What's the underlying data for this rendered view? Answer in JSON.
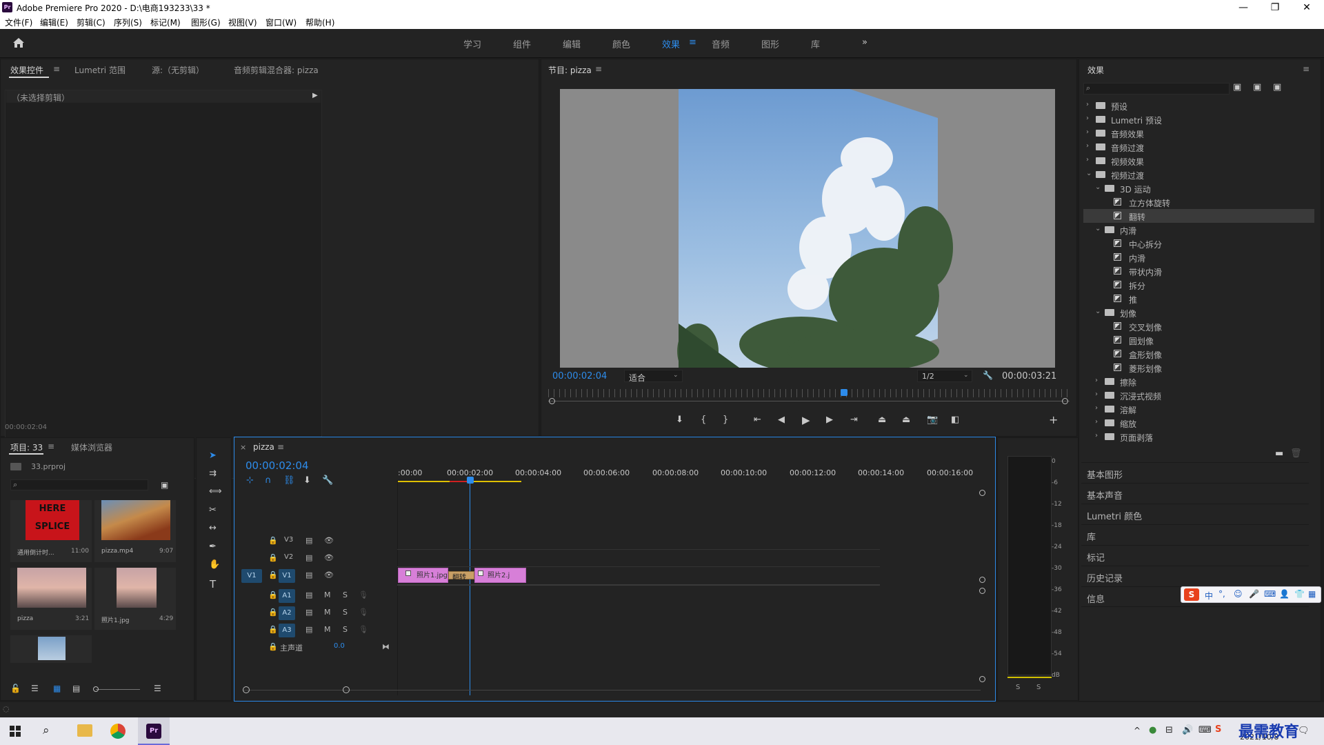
{
  "window": {
    "title": "Adobe Premiere Pro 2020 - D:\\电商193233\\33 *",
    "logo": "Pr",
    "controls": [
      "—",
      "❐",
      "✕"
    ]
  },
  "menu": [
    "文件(F)",
    "编辑(E)",
    "剪辑(C)",
    "序列(S)",
    "标记(M)",
    "图形(G)",
    "视图(V)",
    "窗口(W)",
    "帮助(H)"
  ],
  "workspaces": {
    "items": [
      "学习",
      "组件",
      "编辑",
      "颜色",
      "效果",
      "音频",
      "图形",
      "库"
    ],
    "active": "效果",
    "more": "»",
    "menu_icon": "≡"
  },
  "source_panel": {
    "tabs": [
      "效果控件",
      "Lumetri 范围",
      "源:（无剪辑）",
      "音频剪辑混合器: pizza"
    ],
    "no_clip": "（未选择剪辑）",
    "timecode": "00:00:02:04"
  },
  "program": {
    "title": "节目: pizza",
    "timecode": "00:00:02:04",
    "fit": "适合",
    "quality": "1/2",
    "duration": "00:00:03:21"
  },
  "project": {
    "tabs": [
      "项目: 33",
      "媒体浏览器"
    ],
    "file": "33.prproj",
    "items": [
      {
        "name": "通用倒计时...",
        "duration": "11:00",
        "thumb_text": "HERE SPLICE"
      },
      {
        "name": "pizza.mp4",
        "duration": "9:07"
      },
      {
        "name": "pizza",
        "duration": "3:21"
      },
      {
        "name": "照片1.jpg",
        "duration": "4:29"
      }
    ]
  },
  "timeline": {
    "tab": "pizza",
    "timecode": "00:00:02:04",
    "ruler": [
      ":00:00",
      "00:00:02:00",
      "00:00:04:00",
      "00:00:06:00",
      "00:00:08:00",
      "00:00:10:00",
      "00:00:12:00",
      "00:00:14:00",
      "00:00:16:00"
    ],
    "video_tracks": [
      "V3",
      "V2",
      "V1"
    ],
    "audio_tracks": [
      "A1",
      "A2",
      "A3"
    ],
    "source_patch": "V1",
    "master_label": "主声道",
    "master_value": "0.0",
    "clips": [
      {
        "name": "照片1.jpg"
      },
      {
        "name": "翻转"
      },
      {
        "name": "照片2.j"
      }
    ],
    "track_buttons": {
      "mute": "M",
      "solo": "S"
    }
  },
  "meter": {
    "ticks": [
      "0",
      "-6",
      "-12",
      "-18",
      "-24",
      "-30",
      "-36",
      "-42",
      "-48",
      "-54",
      "dB"
    ],
    "solo": [
      "S",
      "S"
    ]
  },
  "effects": {
    "title": "效果",
    "tree": [
      {
        "label": "预设",
        "level": 0,
        "kind": "folder-special",
        "open": false
      },
      {
        "label": "Lumetri 预设",
        "level": 0,
        "kind": "folder-special",
        "open": false
      },
      {
        "label": "音频效果",
        "level": 0,
        "kind": "folder",
        "open": false
      },
      {
        "label": "音频过渡",
        "level": 0,
        "kind": "folder",
        "open": false
      },
      {
        "label": "视频效果",
        "level": 0,
        "kind": "folder",
        "open": false
      },
      {
        "label": "视频过渡",
        "level": 0,
        "kind": "folder",
        "open": true
      },
      {
        "label": "3D 运动",
        "level": 1,
        "kind": "folder",
        "open": true
      },
      {
        "label": "立方体旋转",
        "level": 2,
        "kind": "fx"
      },
      {
        "label": "翻转",
        "level": 2,
        "kind": "fx",
        "selected": true
      },
      {
        "label": "内滑",
        "level": 1,
        "kind": "folder",
        "open": true
      },
      {
        "label": "中心拆分",
        "level": 2,
        "kind": "fx"
      },
      {
        "label": "内滑",
        "level": 2,
        "kind": "fx"
      },
      {
        "label": "带状内滑",
        "level": 2,
        "kind": "fx"
      },
      {
        "label": "拆分",
        "level": 2,
        "kind": "fx"
      },
      {
        "label": "推",
        "level": 2,
        "kind": "fx"
      },
      {
        "label": "划像",
        "level": 1,
        "kind": "folder",
        "open": true
      },
      {
        "label": "交叉划像",
        "level": 2,
        "kind": "fx"
      },
      {
        "label": "圆划像",
        "level": 2,
        "kind": "fx"
      },
      {
        "label": "盒形划像",
        "level": 2,
        "kind": "fx"
      },
      {
        "label": "菱形划像",
        "level": 2,
        "kind": "fx"
      },
      {
        "label": "擦除",
        "level": 1,
        "kind": "folder",
        "open": false
      },
      {
        "label": "沉浸式视频",
        "level": 1,
        "kind": "folder",
        "open": false
      },
      {
        "label": "溶解",
        "level": 1,
        "kind": "folder",
        "open": false
      },
      {
        "label": "缩放",
        "level": 1,
        "kind": "folder",
        "open": false
      },
      {
        "label": "页面剥落",
        "level": 1,
        "kind": "folder",
        "open": false
      }
    ],
    "sections": [
      "基本图形",
      "基本声音",
      "Lumetri 颜色",
      "库",
      "标记",
      "历史记录",
      "信息"
    ]
  },
  "taskbar": {
    "date": "2021/10/8",
    "ime": "中",
    "watermark": "最需教育"
  }
}
